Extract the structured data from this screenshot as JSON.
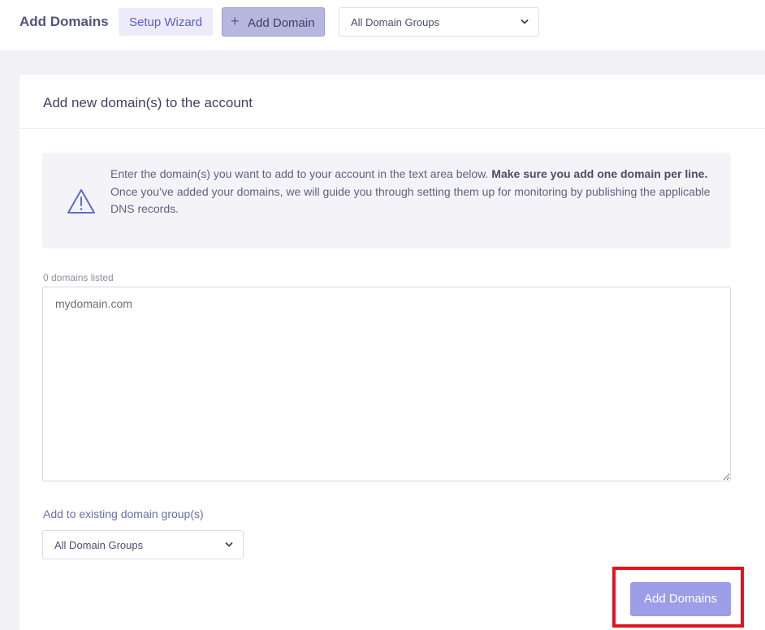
{
  "header": {
    "title": "Add Domains",
    "setup_wizard_label": "Setup Wizard",
    "add_domain_label": "Add Domain",
    "add_domain_icon": "plus-icon",
    "group_filter": {
      "selected": "All Domain Groups",
      "icon": "chevron-down-icon"
    }
  },
  "card": {
    "title": "Add new domain(s) to the account",
    "info": {
      "icon": "warning-icon",
      "line1": "Enter the domain(s) you want to add to your account in the text area below. ",
      "line1_bold": "Make sure you add one domain per line.",
      "line2": "Once you’ve added your domains, we will guide you through setting them up for monitoring by publishing the applicable DNS records."
    },
    "domains_count_label": "0 domains listed",
    "domains_placeholder": "mydomain.com",
    "group_label": "Add to existing domain group(s)",
    "group_select": {
      "selected": "All Domain Groups",
      "icon": "chevron-down-icon"
    },
    "submit_label": "Add Domains"
  },
  "colors": {
    "accent": "#5a5fc8",
    "primary_button": "#9c9ee8",
    "add_domain_button": "#b6b6de",
    "highlight": "#e0141e"
  }
}
